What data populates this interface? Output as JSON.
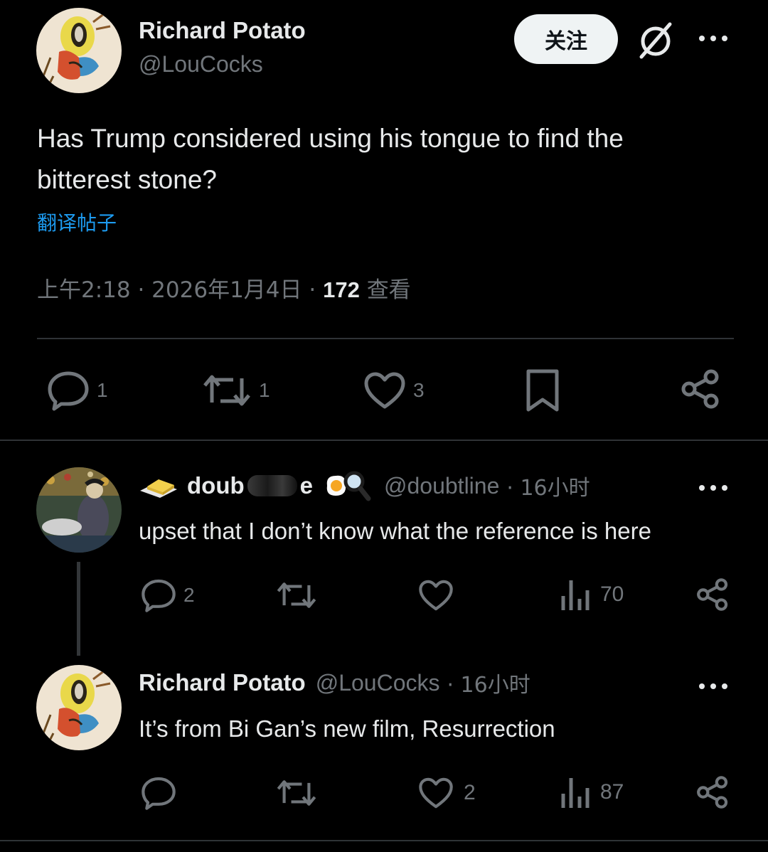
{
  "main_post": {
    "display_name": "Richard Potato",
    "handle": "@LouCocks",
    "follow_label": "关注",
    "text": "Has Trump considered using his tongue to find the bitterest stone?",
    "text_line1": "Has Trump considered using his tongue to find the",
    "text_line2": "bitterest stone?",
    "translate_label": "翻译帖子",
    "time": "上午2:18 · 2026年1月4日",
    "sep": "·",
    "views_count": "172",
    "views_label": "查看",
    "actions": {
      "reply_count": "1",
      "repost_count": "1",
      "like_count": "3"
    }
  },
  "replies": [
    {
      "display_name": "doub",
      "name_suffix": "e",
      "handle": "@doubtline",
      "time": "· 16小时",
      "text": "upset that I don’t know what the reference is here",
      "reply_count": "2",
      "repost_count": "",
      "like_count": "",
      "views_count": "70"
    },
    {
      "display_name": "Richard Potato",
      "handle": "@LouCocks",
      "time": "· 16小时",
      "text": "It’s from Bi Gan’s new film, Resurrection",
      "reply_count": "",
      "repost_count": "",
      "like_count": "2",
      "views_count": "87"
    }
  ],
  "icons": {
    "header_grok": "slashed-circle-icon",
    "more": "more-dots-icon",
    "reply": "reply-bubble-icon",
    "repost": "repost-arrows-icon",
    "like": "heart-icon",
    "bookmark": "bookmark-icon",
    "share": "share-icon",
    "views": "bar-chart-icon",
    "emoji_butter": "butter-emoji-icon",
    "emoji_egg": "fried-egg-emoji-icon",
    "emoji_magnifier": "magnifier-emoji-icon"
  },
  "colors": {
    "background": "#000000",
    "text": "#e7e9ea",
    "secondary": "#71767b",
    "link": "#1d9bf0",
    "divider": "#2f3336",
    "follow_bg": "#eff3f4"
  }
}
